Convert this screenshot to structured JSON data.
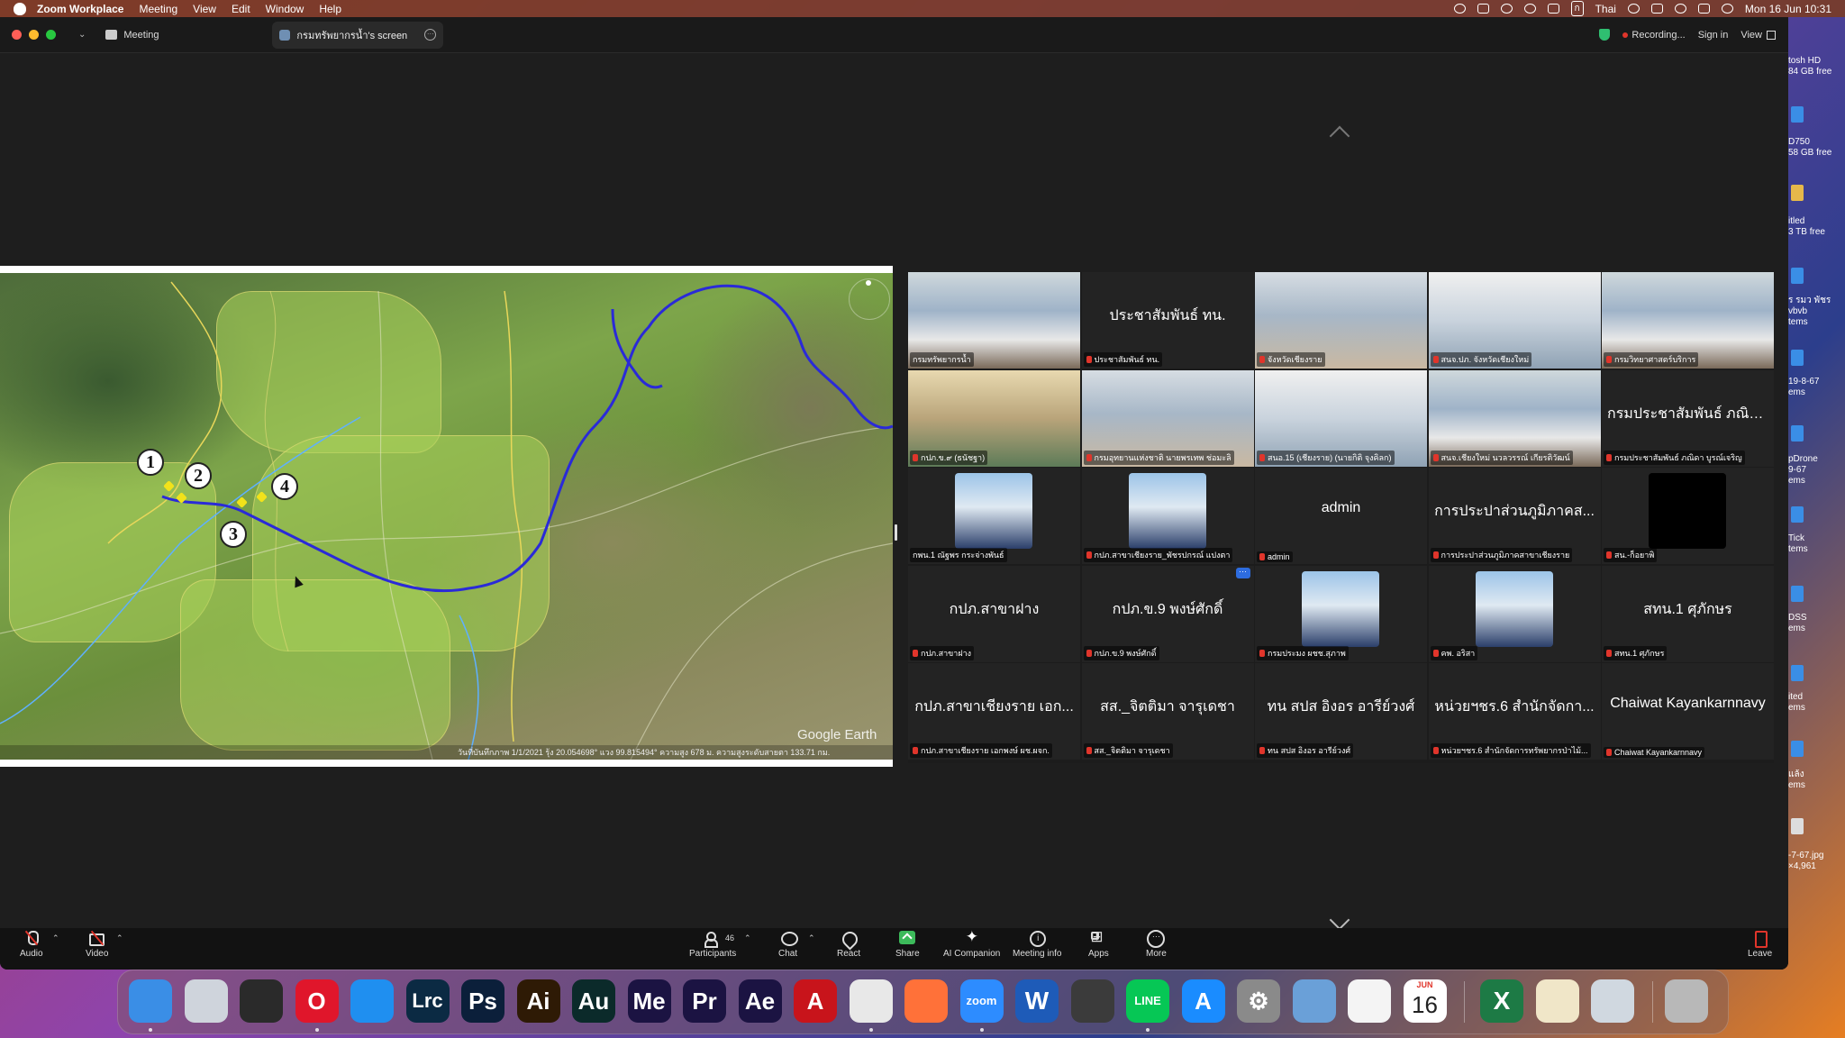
{
  "menubar": {
    "app_name": "Zoom Workplace",
    "items": [
      "Meeting",
      "View",
      "Edit",
      "Window",
      "Help"
    ],
    "input_source": "Thai",
    "datetime": "Mon 16 Jun  10:31"
  },
  "titlebar": {
    "meeting_tab": "Meeting",
    "screen_tab": "กรมทรัพยากรน้ำ's screen",
    "recording": "Recording...",
    "sign_in": "Sign in",
    "view": "View"
  },
  "map": {
    "markers": [
      "1",
      "2",
      "3",
      "4"
    ],
    "logo": "Google Earth",
    "status": "วันที่บันทึกภาพ 1/1/2021   รุ้ง  20.054698°  แวง  99.815494°  ความสูง  678 ม.   ความสูงระดับสายตา 133.71 กม."
  },
  "gallery": {
    "tiles": [
      {
        "big": "",
        "label": "กรมทรัพยากรน้ำ",
        "avatar": "video-room",
        "active": true,
        "muted": false
      },
      {
        "big": "ประชาสัมพันธ์ ทน.",
        "label": "ประชาสัมพันธ์ ทน.",
        "avatar": "",
        "active": false,
        "muted": true
      },
      {
        "big": "",
        "label": "จังหวัดเชียงราย",
        "avatar": "video-room",
        "active": false,
        "muted": true
      },
      {
        "big": "",
        "label": "สนจ.ปภ. จังหวัดเชียงใหม่",
        "avatar": "video-room",
        "active": false,
        "muted": true
      },
      {
        "big": "",
        "label": "กรมวิทยาศาสตร์บริการ",
        "avatar": "video-room",
        "active": false,
        "muted": true
      },
      {
        "big": "",
        "label": "กปภ.ข.๙ (ธนัชฐา)",
        "avatar": "video-room",
        "active": false,
        "muted": true
      },
      {
        "big": "",
        "label": "กรมอุทยานแห่งชาติ นายพรเทพ ช่อมะลิ",
        "avatar": "video-room",
        "active": false,
        "muted": true
      },
      {
        "big": "",
        "label": "สนอ.15 (เชียงราย) (นายกิติ จุงคิลก)",
        "avatar": "video-room",
        "active": false,
        "muted": true
      },
      {
        "big": "",
        "label": "สนจ.เชียงใหม่ นวลวรรณ์ เกียรติวัฒน์",
        "avatar": "video-room",
        "active": false,
        "muted": true
      },
      {
        "big": "กรมประชาสัมพันธ์ ภณิต...",
        "label": "กรมประชาสัมพันธ์ ภณิดา บูรณ์เจริญ",
        "avatar": "",
        "active": false,
        "muted": true
      },
      {
        "big": "",
        "label": "กพน.1 ณัฐพร กระจ่างพันธ์",
        "avatar": "photo",
        "active": false,
        "muted": false
      },
      {
        "big": "",
        "label": "กปภ.สาขาเชียงราย_พัชรปกรณ์ แปงตา",
        "avatar": "photo",
        "active": false,
        "muted": true
      },
      {
        "big": "admin",
        "label": "admin",
        "avatar": "",
        "active": false,
        "muted": true
      },
      {
        "big": "การประปาส่วนภูมิภาคส...",
        "label": "การประปาส่วนภูมิภาคสาขาเชียงราย",
        "avatar": "",
        "active": false,
        "muted": true
      },
      {
        "big": "",
        "label": "สน.-ก็อยาพิ",
        "avatar": "black",
        "active": false,
        "muted": true
      },
      {
        "big": "กปภ.สาขาฝาง",
        "label": "กปภ.สาขาฝาง",
        "avatar": "",
        "active": false,
        "muted": true
      },
      {
        "big": "กปภ.ข.9 พงษ์ศักดิ์",
        "label": "กปภ.ข.9 พงษ์ศักดิ์",
        "avatar": "",
        "active": false,
        "muted": true
      },
      {
        "big": "",
        "label": "กรมประมง ผชช.สุภาพ",
        "avatar": "photo",
        "active": false,
        "muted": true
      },
      {
        "big": "",
        "label": "คพ. อริสา",
        "avatar": "photo",
        "active": false,
        "muted": true
      },
      {
        "big": "สทน.1 ศุภักษร",
        "label": "สทน.1 ศุภักษร",
        "avatar": "",
        "active": false,
        "muted": true
      },
      {
        "big": "กปภ.สาขาเชียงราย เอก...",
        "label": "กปภ.สาขาเชียงราย เอกพงษ์ ผช.ผจก.",
        "avatar": "",
        "active": false,
        "muted": true
      },
      {
        "big": "สส._จิตติมา จารุเดชา",
        "label": "สส._จิตติมา จารุเดชา",
        "avatar": "",
        "active": false,
        "muted": true
      },
      {
        "big": "ทน สปส อิงอร อารีย์วงศ์",
        "label": "ทน สปส อิงอร อารีย์วงศ์",
        "avatar": "",
        "active": false,
        "muted": true
      },
      {
        "big": "หน่วยฯชร.6 สำนักจัดกา...",
        "label": "หน่วยฯชร.6 สำนักจัดการทรัพยากรป่าไม้...",
        "avatar": "",
        "active": false,
        "muted": true
      },
      {
        "big": "Chaiwat Kayankarnnavy",
        "label": "Chaiwat Kayankarnnavy",
        "avatar": "",
        "active": false,
        "muted": true
      }
    ]
  },
  "toolbar": {
    "audio": "Audio",
    "video": "Video",
    "participants": "Participants",
    "participants_count": "46",
    "chat": "Chat",
    "react": "React",
    "share": "Share",
    "ai_companion": "AI Companion",
    "meeting_info": "Meeting info",
    "apps": "Apps",
    "more": "More",
    "leave": "Leave"
  },
  "desktop": {
    "items": [
      "tosh HD",
      "84 GB free",
      "D750",
      "58 GB free",
      "itled",
      "3 TB free",
      "ร รมว พัชร",
      "vbvb",
      "tems",
      "19-8-67",
      "ems",
      "pDrone",
      "9-67",
      "ems",
      "Tick",
      "tems",
      "DSS",
      "ems",
      "ited",
      "ems",
      "แล้ง",
      "ems",
      "-7-67.jpg",
      "×4,961"
    ]
  },
  "dock": {
    "apps": [
      {
        "name": "Finder",
        "glyph": "",
        "color": "#3a8ee6"
      },
      {
        "name": "Launchpad",
        "glyph": "",
        "color": "#cfd4dc"
      },
      {
        "name": "OBS",
        "glyph": "",
        "color": "#2a2a2a"
      },
      {
        "name": "Opera",
        "glyph": "O",
        "color": "#e0162b"
      },
      {
        "name": "Safari",
        "glyph": "",
        "color": "#1f8ff0"
      },
      {
        "name": "Lightroom Classic",
        "glyph": "Lrc",
        "color": "#0b2a43"
      },
      {
        "name": "Photoshop",
        "glyph": "Ps",
        "color": "#0b1f3a"
      },
      {
        "name": "Illustrator",
        "glyph": "Ai",
        "color": "#2e1a05"
      },
      {
        "name": "Audition",
        "glyph": "Au",
        "color": "#0b2a2a"
      },
      {
        "name": "Media Encoder",
        "glyph": "Me",
        "color": "#1b1342"
      },
      {
        "name": "Premiere",
        "glyph": "Pr",
        "color": "#1b1342"
      },
      {
        "name": "After Effects",
        "glyph": "Ae",
        "color": "#1b1342"
      },
      {
        "name": "Acrobat",
        "glyph": "A",
        "color": "#c8141b"
      },
      {
        "name": "Chrome",
        "glyph": "",
        "color": "#e8e8e8"
      },
      {
        "name": "Firefox",
        "glyph": "",
        "color": "#ff7139"
      },
      {
        "name": "Zoom",
        "glyph": "zoom",
        "color": "#2d8cff"
      },
      {
        "name": "Word",
        "glyph": "W",
        "color": "#1e5bb8"
      },
      {
        "name": "Final Cut",
        "glyph": "",
        "color": "#3b3b3b"
      },
      {
        "name": "LINE",
        "glyph": "LINE",
        "color": "#06c755"
      },
      {
        "name": "App Store",
        "glyph": "A",
        "color": "#1a8cff"
      },
      {
        "name": "System Settings",
        "glyph": "⚙",
        "color": "#8a8a8a"
      },
      {
        "name": "Preview",
        "glyph": "",
        "color": "#6aa0d8"
      },
      {
        "name": "Freeform",
        "glyph": "",
        "color": "#f4f4f4"
      },
      {
        "name": "Calendar",
        "glyph": "",
        "color": "#ffffff"
      },
      {
        "name": "Excel",
        "glyph": "X",
        "color": "#1d7a45"
      },
      {
        "name": "Files",
        "glyph": "",
        "color": "#f0e6c8"
      },
      {
        "name": "Mail Drop",
        "glyph": "",
        "color": "#d0d8e0"
      },
      {
        "name": "Trash",
        "glyph": "",
        "color": "#b8b8b8"
      }
    ],
    "calendar": {
      "month": "JUN",
      "day": "16"
    }
  }
}
